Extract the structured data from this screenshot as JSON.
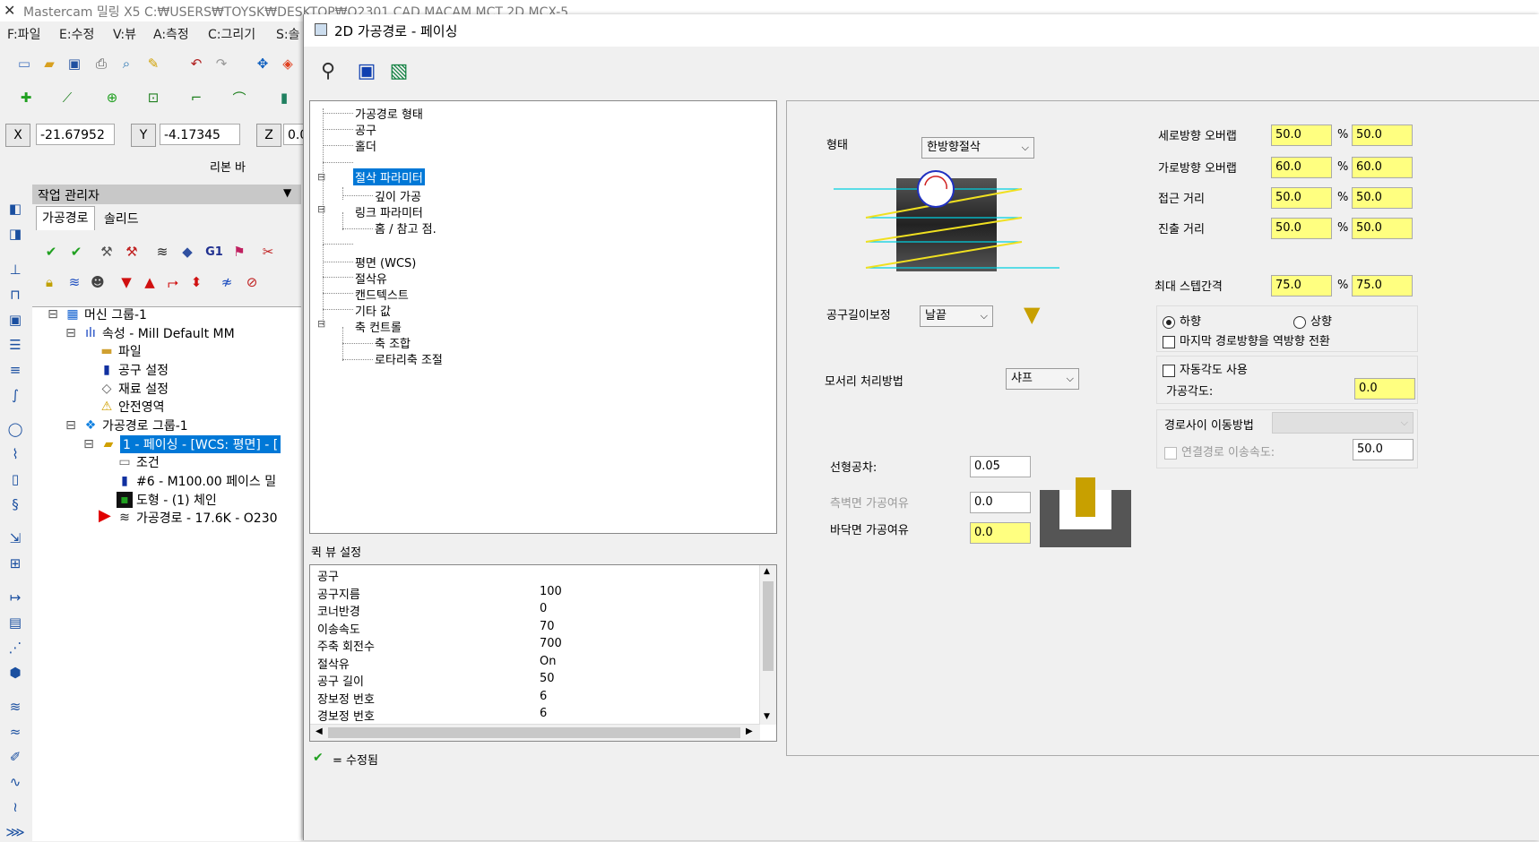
{
  "main_window": {
    "title": "Mastercam 밀링 X5   C:₩USERS₩TOYSK₩DESKTOP₩O2301 CAD MACAM MCT 2D.MCX-5",
    "menu": [
      "F:파일",
      "E:수정",
      "V:뷰",
      "A:측정",
      "C:그리기",
      "S:솔"
    ],
    "coords": {
      "x_label": "X",
      "x_value": "-21.67952",
      "y_label": "Y",
      "y_value": "-4.17345",
      "z_label": "Z",
      "z_value": "0.0"
    },
    "ribbon_label": "리본 바"
  },
  "op_manager": {
    "title": "작업 관리자",
    "tabs": [
      "가공경로",
      "솔리드"
    ],
    "tree": [
      {
        "label": "머신 그룹-1",
        "icon": "machine-group-icon"
      },
      {
        "label": "속성 - Mill Default MM",
        "icon": "properties-icon"
      },
      {
        "label": "파일",
        "icon": "folder-icon"
      },
      {
        "label": "공구 설정",
        "icon": "tool-icon"
      },
      {
        "label": "재료 설정",
        "icon": "stock-icon"
      },
      {
        "label": "안전영역",
        "icon": "warning-icon"
      },
      {
        "label": "가공경로 그룹-1",
        "icon": "toolpath-group-icon"
      },
      {
        "label": "1 - 페이싱 - [WCS: 평면] - [",
        "icon": "operation-folder-icon"
      },
      {
        "label": "조건",
        "icon": "parameters-icon"
      },
      {
        "label": "#6 - M100.00 페이스 밀",
        "icon": "tool-icon"
      },
      {
        "label": "도형 - (1) 체인",
        "icon": "geometry-icon"
      },
      {
        "label": "가공경로 - 17.6K - O230",
        "icon": "toolpath-icon"
      }
    ]
  },
  "dialog": {
    "title": "2D 가공경로 - 페이싱",
    "nav": [
      {
        "label": "가공경로 형태",
        "level": 0
      },
      {
        "label": "공구",
        "level": 0
      },
      {
        "label": "홀더",
        "level": 0
      },
      {
        "label": "절삭 파라미터",
        "level": 0,
        "selected": true
      },
      {
        "label": "깊이 가공",
        "level": 1
      },
      {
        "label": "링크 파라미터",
        "level": 0
      },
      {
        "label": "홈 / 참고 점.",
        "level": 1
      },
      {
        "label": "평면 (WCS)",
        "level": 0
      },
      {
        "label": "절삭유",
        "level": 0
      },
      {
        "label": "캔드텍스트",
        "level": 0
      },
      {
        "label": "기타 값",
        "level": 0
      },
      {
        "label": "축 컨트롤",
        "level": 0
      },
      {
        "label": "축 조합",
        "level": 1
      },
      {
        "label": "로타리축 조절",
        "level": 1
      }
    ],
    "quick_view": {
      "title": "퀵 뷰 설정",
      "rows": [
        {
          "label": "공구",
          "value": ""
        },
        {
          "label": "공구지름",
          "value": "100"
        },
        {
          "label": "코너반경",
          "value": "0"
        },
        {
          "label": "이송속도",
          "value": "70"
        },
        {
          "label": "주축 회전수",
          "value": "700"
        },
        {
          "label": "절삭유",
          "value": "On"
        },
        {
          "label": "공구 길이",
          "value": "50"
        },
        {
          "label": "장보정 번호",
          "value": "6"
        },
        {
          "label": "경보정 번호",
          "value": "6"
        }
      ]
    },
    "footer_legend": "= 수정됨",
    "params": {
      "style_label": "형태",
      "style_value": "한방향절삭",
      "tool_comp_label": "공구길이보정",
      "tool_comp_value": "날끝",
      "corner_label": "모서리 처리방법",
      "corner_value": "샤프",
      "linear_tol_label": "선형공차:",
      "linear_tol_value": "0.05",
      "wall_stock_label": "측벽면 가공여유",
      "wall_stock_value": "0.0",
      "floor_stock_label": "바닥면 가공여유",
      "floor_stock_value": "0.0",
      "overlaps": [
        {
          "label": "세로방향 오버랩",
          "pct": "50.0",
          "val": "50.0"
        },
        {
          "label": "가로방향 오버랩",
          "pct": "60.0",
          "val": "60.0"
        },
        {
          "label": "접근 거리",
          "pct": "50.0",
          "val": "50.0"
        },
        {
          "label": "진출 거리",
          "pct": "50.0",
          "val": "50.0"
        }
      ],
      "percent_sign": "%",
      "max_step_label": "최대 스텝간격",
      "max_step_pct": "75.0",
      "max_step_val": "75.0",
      "dir_down": "하향",
      "dir_up": "상향",
      "reverse_last": "마지막 경로방향을 역방향 전환",
      "auto_angle": "자동각도 사용",
      "angle_label": "가공각도:",
      "angle_value": "0.0",
      "move_between": "경로사이 이동방법",
      "link_feed": "연결경로 이송속도:",
      "link_feed_value": "50.0"
    }
  },
  "colors": {
    "highlight": "#0078d7",
    "yellow_input": "#ffff80",
    "cyan_path": "#00d0e0",
    "yellow_path": "#f0e020"
  }
}
